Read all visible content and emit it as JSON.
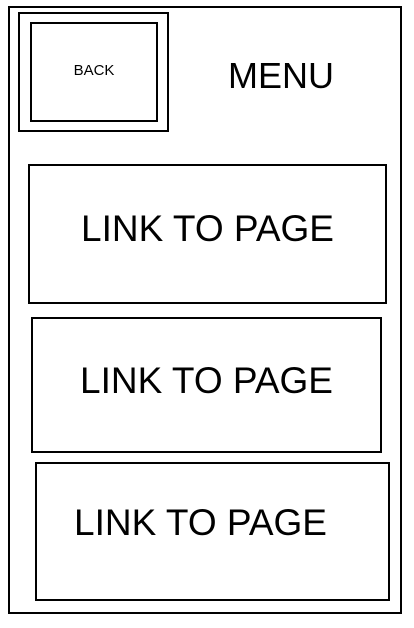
{
  "header": {
    "back_label": "BACK",
    "title": "MENU"
  },
  "menu": {
    "links": [
      {
        "label": "LINK TO PAGE"
      },
      {
        "label": "LINK TO PAGE"
      },
      {
        "label": "LINK TO PAGE"
      }
    ]
  },
  "colors": {
    "border": "#000000",
    "background": "#ffffff",
    "text": "#000000"
  }
}
